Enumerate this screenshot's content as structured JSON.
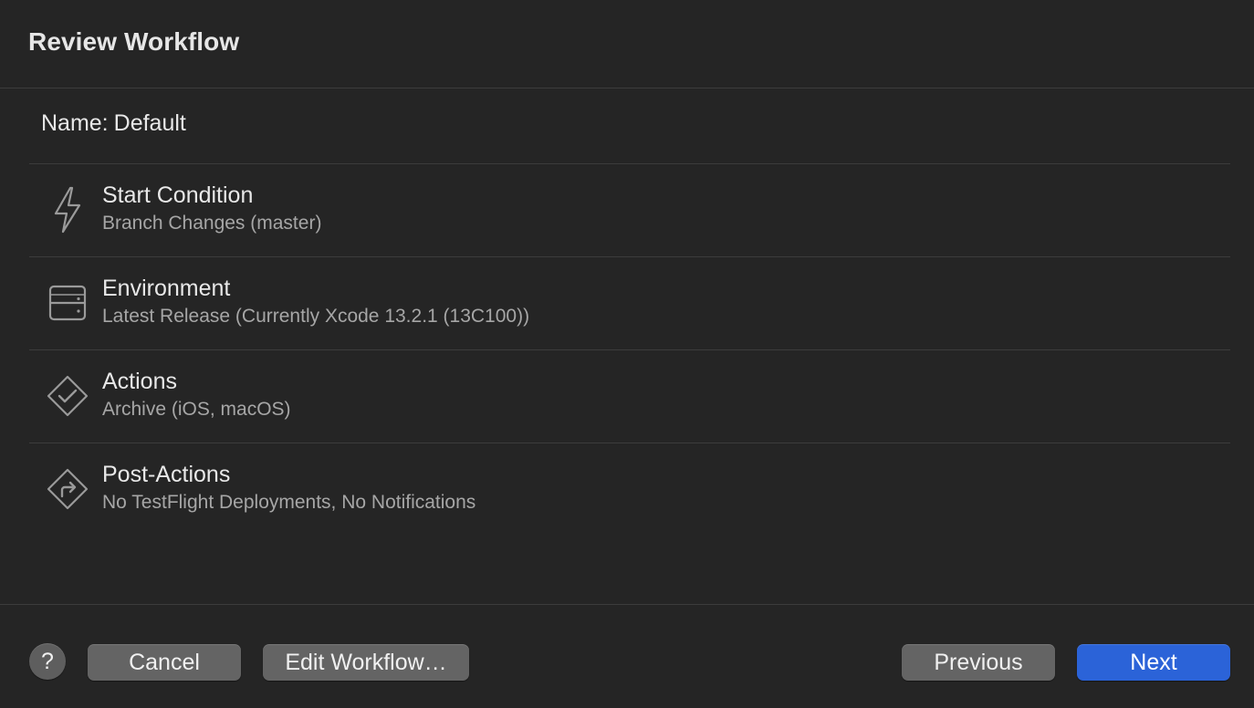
{
  "dialog": {
    "title": "Review Workflow"
  },
  "workflow": {
    "name_label": "Name:",
    "name_value": "Default"
  },
  "items": [
    {
      "icon": "lightning-bolt-icon",
      "title": "Start Condition",
      "subtitle": "Branch Changes (master)"
    },
    {
      "icon": "server-drive-icon",
      "title": "Environment",
      "subtitle": "Latest Release (Currently Xcode 13.2.1 (13C100))"
    },
    {
      "icon": "diamond-checkmark-icon",
      "title": "Actions",
      "subtitle": "Archive (iOS, macOS)"
    },
    {
      "icon": "diamond-turn-arrow-icon",
      "title": "Post-Actions",
      "subtitle": "No TestFlight Deployments, No Notifications"
    }
  ],
  "footer": {
    "help_label": "?",
    "cancel_label": "Cancel",
    "edit_label": "Edit Workflow…",
    "previous_label": "Previous",
    "next_label": "Next"
  },
  "colors": {
    "background": "#252525",
    "primary_button": "#2b63d8",
    "secondary_button": "#646464"
  }
}
